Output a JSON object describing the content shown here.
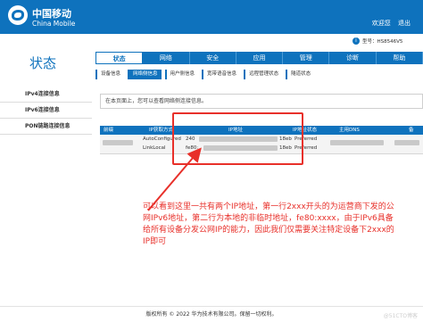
{
  "header": {
    "logo_cn": "中国移动",
    "logo_en": "China Mobile",
    "welcome": "欢迎您",
    "logout": "退出"
  },
  "user_info": "型号：HS8546V5",
  "section_title": "状态",
  "main_tabs": [
    {
      "label": "状态",
      "active": true
    },
    {
      "label": "网络",
      "active": false
    },
    {
      "label": "安全",
      "active": false
    },
    {
      "label": "应用",
      "active": false
    },
    {
      "label": "管理",
      "active": false
    },
    {
      "label": "诊断",
      "active": false
    },
    {
      "label": "帮助",
      "active": false
    }
  ],
  "sub_tabs": [
    {
      "label": "设备信息",
      "active": false
    },
    {
      "label": "网络侧信息",
      "active": true
    },
    {
      "label": "用户侧信息",
      "active": false
    },
    {
      "label": "宽带语音信息",
      "active": false
    },
    {
      "label": "远程管理状态",
      "active": false
    },
    {
      "label": "隧道状态",
      "active": false
    }
  ],
  "sidebar": {
    "items": [
      {
        "label": "IPv4连接信息"
      },
      {
        "label": "IPv6连接信息"
      },
      {
        "label": "PON链路连接信息"
      }
    ]
  },
  "breadcrumb": "在本页面上，您可以查看网络侧连接信息。",
  "table": {
    "headers": [
      "前缀",
      "IP获取方式",
      "IP地址",
      "IP地址状态",
      "主用DNS",
      "备"
    ],
    "rows": [
      {
        "method": "AutoConfigured",
        "ip_start": "240",
        "ip_end": "18eb",
        "status": "Preferred"
      },
      {
        "method": "LinkLocal",
        "ip_start": "fe80:",
        "ip_end": "18eb",
        "status": "Preferred"
      }
    ]
  },
  "annotation": "可以看到这里一共有两个IP地址，第一行2xxx开头的为运营商下发的公网IPv6地址，第二行为本地的非临时地址，fe80:xxxx，由于IPv6具备给所有设备分发公网IP的能力，因此我们仅需要关注特定设备下2xxx的IP即可",
  "footer": "版权所有 © 2022 华为技术有限公司。保留一切权利。",
  "watermark": "@51CTO博客",
  "colors": {
    "brand": "#0e72bd",
    "annotation": "#e8302a"
  }
}
